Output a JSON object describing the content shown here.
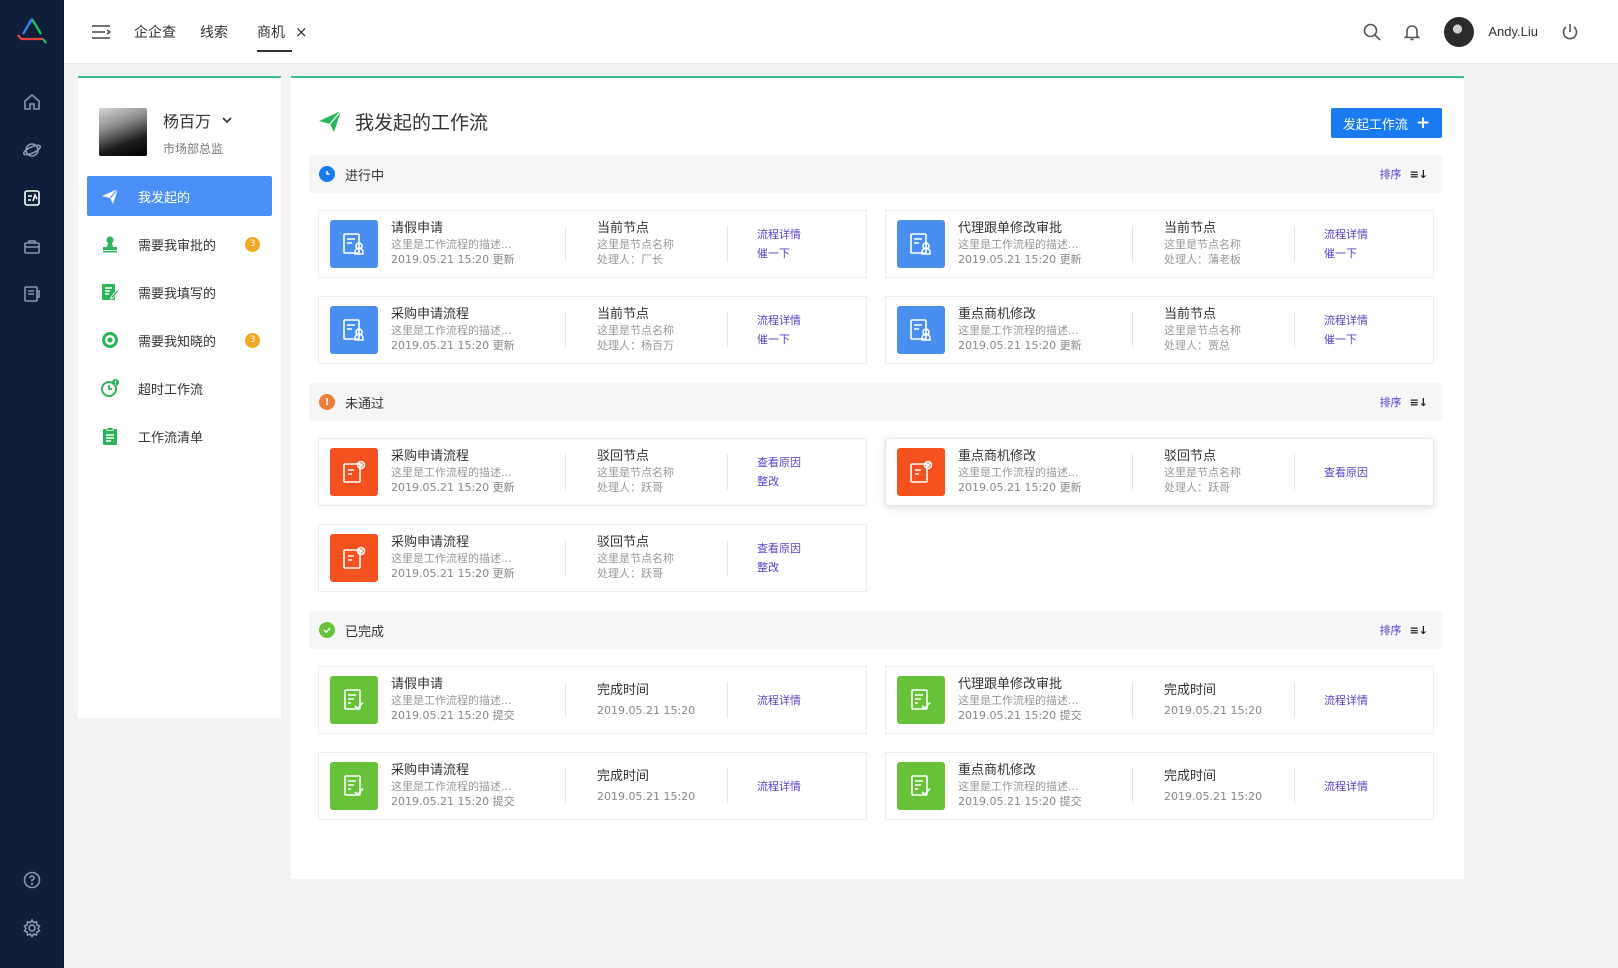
{
  "topbar": {
    "tabs": [
      {
        "label": "企企查",
        "active": false
      },
      {
        "label": "线索",
        "active": false
      },
      {
        "label": "商机",
        "active": true
      }
    ],
    "tab_close": "×",
    "user_name": "Andy.Liu"
  },
  "rail": {
    "items": [
      "home-icon",
      "planet-icon",
      "workflow-icon",
      "briefcase-icon",
      "contract-icon"
    ],
    "active_index": 2,
    "bottom": [
      "help-icon",
      "settings-icon"
    ]
  },
  "profile": {
    "name": "杨百万",
    "role": "市场部总监"
  },
  "nav": [
    {
      "label": "我发起的",
      "icon": "paper-plane-icon",
      "active": true,
      "badge": null
    },
    {
      "label": "需要我审批的",
      "icon": "stamp-icon",
      "active": false,
      "badge": "3"
    },
    {
      "label": "需要我填写的",
      "icon": "edit-form-icon",
      "active": false,
      "badge": null
    },
    {
      "label": "需要我知晓的",
      "icon": "eye-icon",
      "active": false,
      "badge": "3"
    },
    {
      "label": "超时工作流",
      "icon": "timeout-clock-icon",
      "active": false,
      "badge": null
    },
    {
      "label": "工作流清单",
      "icon": "clipboard-icon",
      "active": false,
      "badge": null
    }
  ],
  "main": {
    "title": "我发起的工作流",
    "start_button": "发起工作流",
    "start_plus": "+",
    "sort_label": "排序",
    "sort_icon": "≡↓"
  },
  "sections": {
    "in_progress": {
      "title": "进行中",
      "cards": [
        {
          "title": "请假申请",
          "desc": "这里是工作流程的描述...",
          "time": "2019.05.21  15:20  更新",
          "node_title": "当前节点",
          "node_name": "这里是节点名称",
          "handler": "处理人：厂长",
          "actions": [
            "流程详情",
            "催一下"
          ]
        },
        {
          "title": "代理跟单修改审批",
          "desc": "这里是工作流程的描述...",
          "time": "2019.05.21  15:20  更新",
          "node_title": "当前节点",
          "node_name": "这里是节点名称",
          "handler": "处理人：蒲老板",
          "actions": [
            "流程详情",
            "催一下"
          ]
        },
        {
          "title": "采购申请流程",
          "desc": "这里是工作流程的描述...",
          "time": "2019.05.21  15:20  更新",
          "node_title": "当前节点",
          "node_name": "这里是节点名称",
          "handler": "处理人：杨百万",
          "actions": [
            "流程详情",
            "催一下"
          ]
        },
        {
          "title": "重点商机修改",
          "desc": "这里是工作流程的描述...",
          "time": "2019.05.21  15:20  更新",
          "node_title": "当前节点",
          "node_name": "这里是节点名称",
          "handler": "处理人：贾总",
          "actions": [
            "流程详情",
            "催一下"
          ]
        }
      ]
    },
    "rejected": {
      "title": "未通过",
      "cards": [
        {
          "title": "采购申请流程",
          "desc": "这里是工作流程的描述...",
          "time": "2019.05.21  15:20  更新",
          "node_title": "驳回节点",
          "node_name": "这里是节点名称",
          "handler": "处理人：跃哥",
          "actions": [
            "查看原因",
            "整改"
          ]
        },
        {
          "title": "重点商机修改",
          "desc": "这里是工作流程的描述...",
          "time": "2019.05.21  15:20  更新",
          "node_title": "驳回节点",
          "node_name": "这里是节点名称",
          "handler": "处理人：跃哥",
          "actions": [
            "查看原因"
          ]
        },
        {
          "title": "采购申请流程",
          "desc": "这里是工作流程的描述...",
          "time": "2019.05.21  15:20  更新",
          "node_title": "驳回节点",
          "node_name": "这里是节点名称",
          "handler": "处理人：跃哥",
          "actions": [
            "查看原因",
            "整改"
          ]
        }
      ]
    },
    "completed": {
      "title": "已完成",
      "cards": [
        {
          "title": "请假申请",
          "desc": "这里是工作流程的描述...",
          "time": "2019.05.21  15:20  提交",
          "node_title": "完成时间",
          "finish_time": "2019.05.21  15:20",
          "actions": [
            "流程详情"
          ]
        },
        {
          "title": "代理跟单修改审批",
          "desc": "这里是工作流程的描述...",
          "time": "2019.05.21  15:20  提交",
          "node_title": "完成时间",
          "finish_time": "2019.05.21  15:20",
          "actions": [
            "流程详情"
          ]
        },
        {
          "title": "采购申请流程",
          "desc": "这里是工作流程的描述...",
          "time": "2019.05.21  15:20  提交",
          "node_title": "完成时间",
          "finish_time": "2019.05.21  15:20",
          "actions": [
            "流程详情"
          ]
        },
        {
          "title": "重点商机修改",
          "desc": "这里是工作流程的描述...",
          "time": "2019.05.21  15:20  提交",
          "node_title": "完成时间",
          "finish_time": "2019.05.21  15:20",
          "actions": [
            "流程详情"
          ]
        }
      ]
    }
  },
  "colors": {
    "rail_bg": "#0f1f3a",
    "accent_blue": "#1a7bf0",
    "nav_active": "#4a90f6",
    "link_purple": "#5b3ec8",
    "section_green_line": "#3cc08f",
    "status_blue": "#1a7bf0",
    "status_orange": "#f07c3a",
    "status_green": "#67c23a",
    "card_blue": "#4a8ff0",
    "card_red": "#f4511e",
    "card_green": "#67c23a",
    "badge": "#f5a623"
  }
}
